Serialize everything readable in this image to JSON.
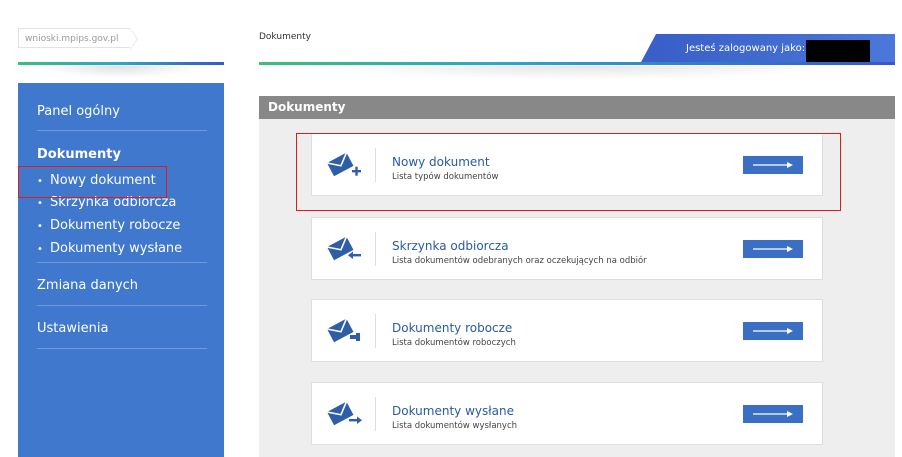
{
  "site": {
    "domain": "wnioski.mpips.gov.pl"
  },
  "header": {
    "breadcrumb": "Dokumenty",
    "logged_in_label": "Jesteś zalogowany jako:"
  },
  "sidebar": {
    "items": [
      {
        "label": "Panel ogólny"
      },
      {
        "label": "Dokumenty"
      },
      {
        "label": "Zmiana danych"
      },
      {
        "label": "Ustawienia"
      }
    ],
    "sub_items": [
      {
        "label": "Nowy dokument"
      },
      {
        "label": "Skrzynka odbiorcza"
      },
      {
        "label": "Dokumenty robocze"
      },
      {
        "label": "Dokumenty wysłane"
      }
    ]
  },
  "main": {
    "title": "Dokumenty",
    "cards": [
      {
        "title": "Nowy dokument",
        "subtitle": "Lista typów dokumentów",
        "icon": "envelope-plus-icon"
      },
      {
        "title": "Skrzynka odbiorcza",
        "subtitle": "Lista dokumentów odebranych oraz oczekujących na odbiór",
        "icon": "envelope-inbox-icon"
      },
      {
        "title": "Dokumenty robocze",
        "subtitle": "Lista dokumentów roboczych",
        "icon": "envelope-draft-icon"
      },
      {
        "title": "Dokumenty wysłane",
        "subtitle": "Lista dokumentów wysłanych",
        "icon": "envelope-sent-icon"
      }
    ]
  },
  "colors": {
    "sidebar": "#3f78cc",
    "accent": "#3a6fc4",
    "highlight": "#e01b1b",
    "title_bar": "#888888"
  }
}
